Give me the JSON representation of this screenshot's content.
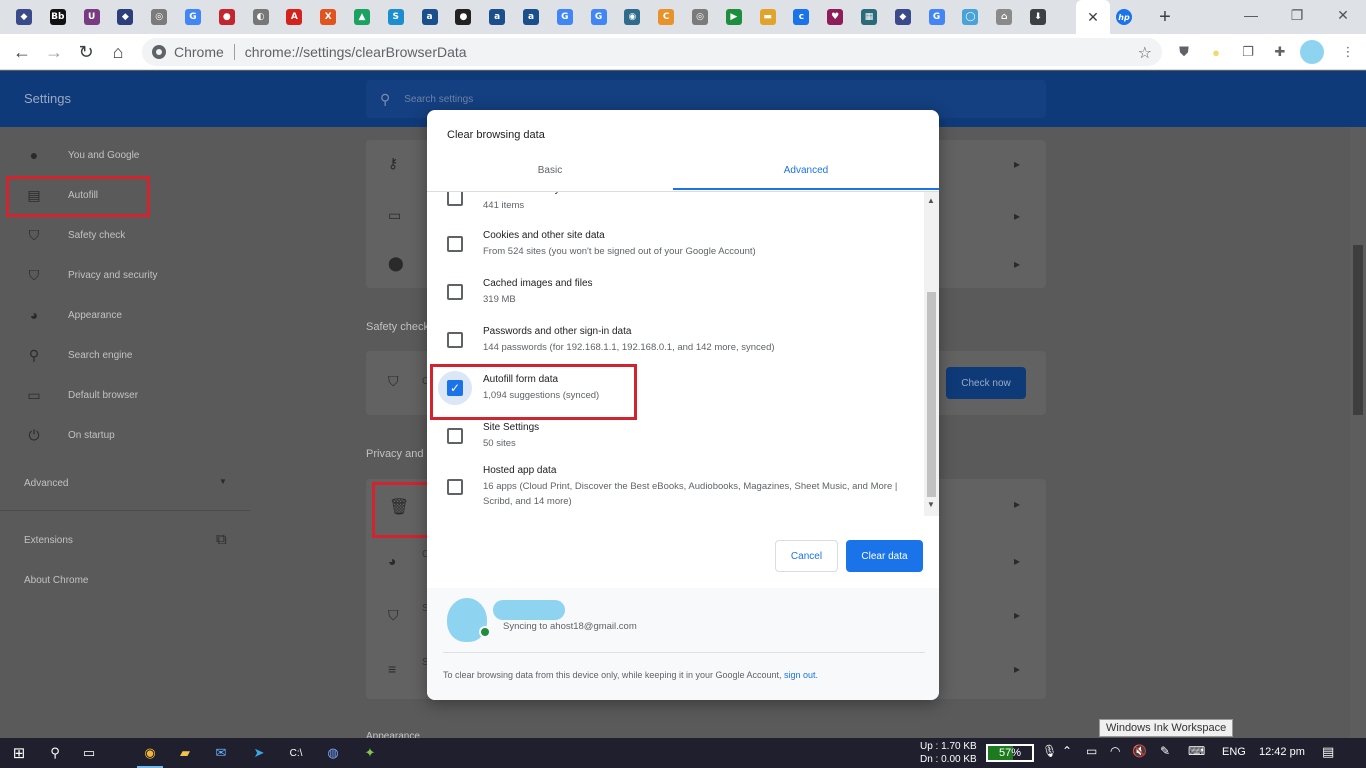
{
  "browser": {
    "tabs": [
      {
        "icon": "shield-tab-icon",
        "glyph": "◆",
        "color": "#3b4a8a"
      },
      {
        "icon": "bb-tab-icon",
        "glyph": "Bb",
        "color": "#111111"
      },
      {
        "icon": "frame-tab-icon",
        "glyph": "U",
        "color": "#7a3c80"
      },
      {
        "icon": "diamond-tab-icon",
        "glyph": "◆",
        "color": "#2c3f7a"
      },
      {
        "icon": "globe-tab-icon",
        "glyph": "◎",
        "color": "#7b7b7b"
      },
      {
        "icon": "google-tab-icon",
        "glyph": "G",
        "color": "#4285f4"
      },
      {
        "icon": "fruit-tab-icon",
        "glyph": "●",
        "color": "#c2262e"
      },
      {
        "icon": "shield2-tab-icon",
        "glyph": "◐",
        "color": "#777777"
      },
      {
        "icon": "adobe-tab-icon",
        "glyph": "A",
        "color": "#d4231c"
      },
      {
        "icon": "x-tab-icon",
        "glyph": "X",
        "color": "#e0551f"
      },
      {
        "icon": "drive-tab-icon",
        "glyph": "▲",
        "color": "#1aa260"
      },
      {
        "icon": "s-tab-icon",
        "glyph": "S",
        "color": "#1c8ecf"
      },
      {
        "icon": "a-tab-icon",
        "glyph": "a",
        "color": "#1a4f8c"
      },
      {
        "icon": "github-tab-icon",
        "glyph": "●",
        "color": "#222222"
      },
      {
        "icon": "a2-tab-icon",
        "glyph": "a",
        "color": "#1a4f8c"
      },
      {
        "icon": "a3-tab-icon",
        "glyph": "a",
        "color": "#1a4f8c"
      },
      {
        "icon": "google2-tab-icon",
        "glyph": "G",
        "color": "#4285f4"
      },
      {
        "icon": "google3-tab-icon",
        "glyph": "G",
        "color": "#4285f4"
      },
      {
        "icon": "circle-tab-icon",
        "glyph": "◉",
        "color": "#2f6b8a"
      },
      {
        "icon": "c-tab-icon",
        "glyph": "C",
        "color": "#e8922b"
      },
      {
        "icon": "globe2-tab-icon",
        "glyph": "◎",
        "color": "#7b7b7b"
      },
      {
        "icon": "play-tab-icon",
        "glyph": "▶",
        "color": "#1e8e3e"
      },
      {
        "icon": "slides-tab-icon",
        "glyph": "▬",
        "color": "#e2a32b"
      },
      {
        "icon": "c2-tab-icon",
        "glyph": "c",
        "color": "#1a73e8"
      },
      {
        "icon": "heart-tab-icon",
        "glyph": "♥",
        "color": "#8e1e5a"
      },
      {
        "icon": "chart-tab-icon",
        "glyph": "▦",
        "color": "#2a6a7a"
      },
      {
        "icon": "shield3-tab-icon",
        "glyph": "◆",
        "color": "#3b4a8a"
      },
      {
        "icon": "google4-tab-icon",
        "glyph": "G",
        "color": "#4285f4"
      },
      {
        "icon": "ring-tab-icon",
        "glyph": "◯",
        "color": "#4aa3d6"
      },
      {
        "icon": "cap-tab-icon",
        "glyph": "⌂",
        "color": "#8a8a8a"
      },
      {
        "icon": "download-tab-icon",
        "glyph": "⬇",
        "color": "#3c4043"
      }
    ],
    "active_tab": {
      "icon": "hp-tab-icon",
      "glyph": "hp",
      "color": "#1a73e8"
    },
    "omnibox_chip": "Chrome",
    "omnibox_url": "chrome://settings/clearBrowserData"
  },
  "settings": {
    "title": "Settings",
    "search_placeholder": "Search settings",
    "sidebar": [
      {
        "name": "you-and-google",
        "label": "You and Google",
        "icon": "person-icon",
        "glyph": "●"
      },
      {
        "name": "autofill",
        "label": "Autofill",
        "icon": "clipboard-icon",
        "glyph": "▤"
      },
      {
        "name": "safety-check",
        "label": "Safety check",
        "icon": "shield-check-icon",
        "glyph": "⛉"
      },
      {
        "name": "privacy-and-security",
        "label": "Privacy and security",
        "icon": "shield-icon",
        "glyph": "⛉"
      },
      {
        "name": "appearance",
        "label": "Appearance",
        "icon": "palette-icon",
        "glyph": "◕"
      },
      {
        "name": "search-engine",
        "label": "Search engine",
        "icon": "search-icon",
        "glyph": "⚲"
      },
      {
        "name": "default-browser",
        "label": "Default browser",
        "icon": "browser-icon",
        "glyph": "▭"
      },
      {
        "name": "on-startup",
        "label": "On startup",
        "icon": "power-icon",
        "glyph": "⏻"
      }
    ],
    "advanced_label": "Advanced",
    "extensions_label": "Extensions",
    "about_label": "About Chrome",
    "safety_heading": "Safety check",
    "safety_peek": "C",
    "privacy_heading": "Privacy and",
    "check_now": "Check now",
    "privacy_row_letters": [
      "C",
      "S",
      "S"
    ],
    "appearance_heading": "Appearance"
  },
  "dialog": {
    "title": "Clear browsing data",
    "tabs": [
      "Basic",
      "Advanced"
    ],
    "active_tab": "Advanced",
    "items": [
      {
        "name": "download-history",
        "title": "Download history",
        "subtitle": "441 items",
        "checked": false
      },
      {
        "name": "cookies",
        "title": "Cookies and other site data",
        "subtitle": "From 524 sites (you won't be signed out of your Google Account)",
        "checked": false
      },
      {
        "name": "cached-images",
        "title": "Cached images and files",
        "subtitle": "319 MB",
        "checked": false
      },
      {
        "name": "passwords",
        "title": "Passwords and other sign-in data",
        "subtitle": "144 passwords (for 192.168.1.1, 192.168.0.1, and 142 more, synced)",
        "checked": false
      },
      {
        "name": "autofill-form-data",
        "title": "Autofill form data",
        "subtitle": "1,094 suggestions (synced)",
        "checked": true
      },
      {
        "name": "site-settings",
        "title": "Site Settings",
        "subtitle": "50 sites",
        "checked": false
      },
      {
        "name": "hosted-app-data",
        "title": "Hosted app data",
        "subtitle": "16 apps (Cloud Print, Discover the Best eBooks, Audiobooks, Magazines, Sheet Music, and More |",
        "subtitle2": "Scribd, and 14 more)",
        "checked": false
      }
    ],
    "cancel": "Cancel",
    "clear": "Clear data",
    "sync_text": "Syncing to ahost18@gmail.com",
    "footer_text": "To clear browsing data from this device only, while keeping it in your Google Account,",
    "footer_link": "sign out."
  },
  "tooltip": "Windows Ink Workspace",
  "taskbar": {
    "net_up": "Up : 1.70 KB",
    "net_down": "Dn : 0.00 KB",
    "battery": "57%",
    "battery_level": 0.57,
    "lang": "ENG",
    "time": "12:42 pm"
  },
  "colors": {
    "accent": "#1a73e8",
    "highlight": "#d3232e",
    "settings_header": "#0f3a7a"
  }
}
